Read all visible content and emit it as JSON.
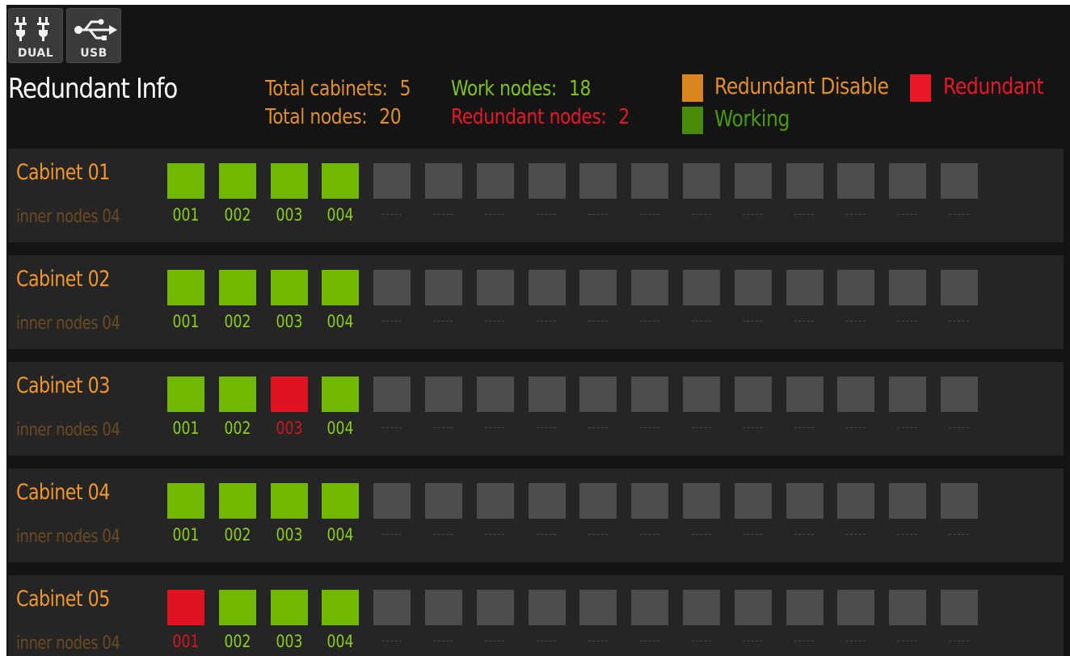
{
  "toolbar": {
    "buttons": [
      {
        "label": "DUAL",
        "icon": "dual-power-icon"
      },
      {
        "label": "USB",
        "icon": "usb-icon"
      }
    ]
  },
  "header": {
    "title": "Redundant Info",
    "total_cabinets_label": "Total cabinets:",
    "total_cabinets_value": "5",
    "total_nodes_label": "Total nodes:",
    "total_nodes_value": "20",
    "work_nodes_label": "Work nodes:",
    "work_nodes_value": "18",
    "redundant_nodes_label": "Redundant nodes:",
    "redundant_nodes_value": "2"
  },
  "legend": {
    "redundant_disable": "Redundant Disable",
    "redundant": "Redundant",
    "working": "Working"
  },
  "colors": {
    "working": "#73b800",
    "redundant": "#e01420",
    "redundant_disable": "#d9861f",
    "empty": "#4d4d4d",
    "legend_working": "#4a8a0a"
  },
  "slots_per_cabinet": 16,
  "empty_slot_label": "-----",
  "cabinets": [
    {
      "name": "Cabinet 01",
      "sub": "inner nodes 04",
      "nodes": [
        {
          "id": "001",
          "state": "working"
        },
        {
          "id": "002",
          "state": "working"
        },
        {
          "id": "003",
          "state": "working"
        },
        {
          "id": "004",
          "state": "working"
        }
      ]
    },
    {
      "name": "Cabinet 02",
      "sub": "inner nodes 04",
      "nodes": [
        {
          "id": "001",
          "state": "working"
        },
        {
          "id": "002",
          "state": "working"
        },
        {
          "id": "003",
          "state": "working"
        },
        {
          "id": "004",
          "state": "working"
        }
      ]
    },
    {
      "name": "Cabinet 03",
      "sub": "inner nodes 04",
      "nodes": [
        {
          "id": "001",
          "state": "working"
        },
        {
          "id": "002",
          "state": "working"
        },
        {
          "id": "003",
          "state": "redundant"
        },
        {
          "id": "004",
          "state": "working"
        }
      ]
    },
    {
      "name": "Cabinet 04",
      "sub": "inner nodes 04",
      "nodes": [
        {
          "id": "001",
          "state": "working"
        },
        {
          "id": "002",
          "state": "working"
        },
        {
          "id": "003",
          "state": "working"
        },
        {
          "id": "004",
          "state": "working"
        }
      ]
    },
    {
      "name": "Cabinet 05",
      "sub": "inner nodes 04",
      "nodes": [
        {
          "id": "001",
          "state": "redundant"
        },
        {
          "id": "002",
          "state": "working"
        },
        {
          "id": "003",
          "state": "working"
        },
        {
          "id": "004",
          "state": "working"
        }
      ]
    }
  ]
}
